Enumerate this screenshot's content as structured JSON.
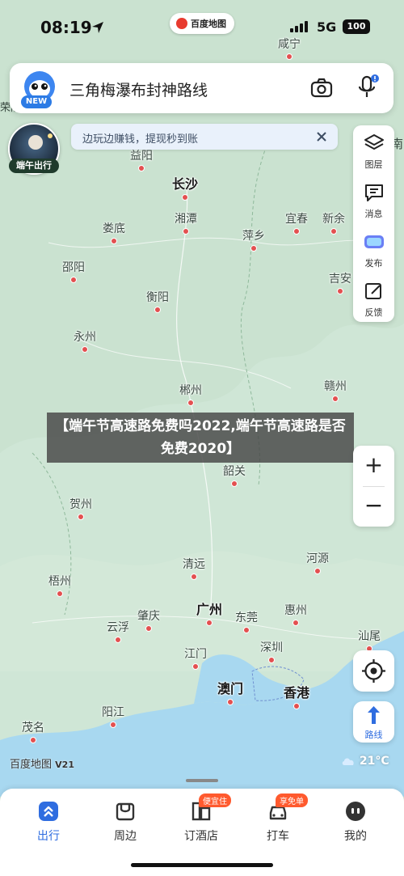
{
  "status_bar": {
    "time": "08:19",
    "network": "5G",
    "battery": "100",
    "brand_pill": "百度地图"
  },
  "search": {
    "query": "三角梅瀑布封神路线",
    "new_badge": "NEW"
  },
  "avatar": {
    "label": "端午出行"
  },
  "tip": {
    "text": "边玩边赚钱，提现秒到账"
  },
  "right_toolbar": {
    "items": [
      {
        "label": "图层",
        "icon": "layers-icon"
      },
      {
        "label": "消息",
        "icon": "message-icon"
      },
      {
        "label": "发布",
        "icon": "publish-icon"
      },
      {
        "label": "反馈",
        "icon": "feedback-icon"
      }
    ]
  },
  "map": {
    "cities": [
      {
        "name": "咸宁"
      },
      {
        "name": "益阳"
      },
      {
        "name": "长沙",
        "major": true
      },
      {
        "name": "湘潭"
      },
      {
        "name": "娄底"
      },
      {
        "name": "萍乡"
      },
      {
        "name": "宜春"
      },
      {
        "name": "新余"
      },
      {
        "name": "邵阳"
      },
      {
        "name": "吉安"
      },
      {
        "name": "衡阳"
      },
      {
        "name": "永州"
      },
      {
        "name": "郴州"
      },
      {
        "name": "赣州"
      },
      {
        "name": "韶关"
      },
      {
        "name": "贺州"
      },
      {
        "name": "清远"
      },
      {
        "name": "河源"
      },
      {
        "name": "梧州"
      },
      {
        "name": "广州",
        "major": true
      },
      {
        "name": "惠州"
      },
      {
        "name": "肇庆"
      },
      {
        "name": "东莞"
      },
      {
        "name": "云浮"
      },
      {
        "name": "江门"
      },
      {
        "name": "深圳"
      },
      {
        "name": "汕尾"
      },
      {
        "name": "澳门",
        "major": true
      },
      {
        "name": "香港",
        "major": true
      },
      {
        "name": "阳江"
      },
      {
        "name": "茂名"
      }
    ],
    "edge_labels": {
      "left_top": "荣陵",
      "right_top": "南"
    }
  },
  "headline": "【端午节高速路免费吗2022,端午节高速路是否免费2020】",
  "zoom": {
    "in": "+",
    "out": "−"
  },
  "route": {
    "label": "路线"
  },
  "scale": {
    "brand": "百度地图",
    "version": "V21"
  },
  "weather": {
    "temp": "21°C"
  },
  "tabbar": {
    "tabs": [
      {
        "label": "出行",
        "active": true,
        "badge": ""
      },
      {
        "label": "周边",
        "active": false,
        "badge": ""
      },
      {
        "label": "订酒店",
        "active": false,
        "badge": "便宜住"
      },
      {
        "label": "打车",
        "active": false,
        "badge": "享免单"
      },
      {
        "label": "我的",
        "active": false,
        "badge": ""
      }
    ]
  },
  "colors": {
    "accent": "#2f6de0",
    "city_dot": "#e35050",
    "badge": "#ff5a2e"
  }
}
